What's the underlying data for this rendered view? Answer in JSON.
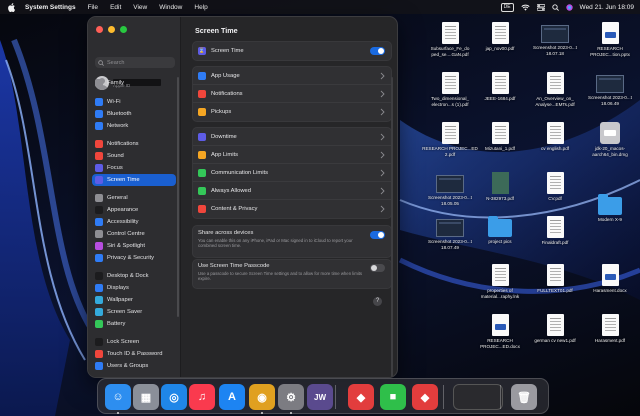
{
  "menubar": {
    "app_name": "System Settings",
    "menus": [
      "File",
      "Edit",
      "View",
      "Window",
      "Help"
    ],
    "input_source": "DE",
    "clock": "Wed 21. Jun  18:09"
  },
  "window": {
    "search": {
      "placeholder": "Search",
      "value": ""
    },
    "account": {
      "name": "",
      "subtitle": "Apple ID"
    },
    "sidebar": [
      {
        "label": "Family",
        "icon": "family-icon",
        "color": "#8e8e93"
      },
      {
        "label": "Wi-Fi",
        "icon": "wifi-icon",
        "color": "#2f7cf6"
      },
      {
        "label": "Bluetooth",
        "icon": "bluetooth-icon",
        "color": "#2f7cf6"
      },
      {
        "label": "Network",
        "icon": "network-icon",
        "color": "#2f7cf6"
      },
      {
        "label": "Notifications",
        "icon": "notifications-icon",
        "color": "#f0463c"
      },
      {
        "label": "Sound",
        "icon": "sound-icon",
        "color": "#f0463c"
      },
      {
        "label": "Focus",
        "icon": "focus-icon",
        "color": "#5e5ce6"
      },
      {
        "label": "Screen Time",
        "icon": "screen-time-icon",
        "color": "#5e5ce6",
        "selected": true
      },
      {
        "label": "General",
        "icon": "general-icon",
        "color": "#8e8e93"
      },
      {
        "label": "Appearance",
        "icon": "appearance-icon",
        "color": "#1c1c1e"
      },
      {
        "label": "Accessibility",
        "icon": "accessibility-icon",
        "color": "#2f7cf6"
      },
      {
        "label": "Control Centre",
        "icon": "control-centre-icon",
        "color": "#8e8e93"
      },
      {
        "label": "Siri & Spotlight",
        "icon": "siri-icon",
        "color": "#b84ee0"
      },
      {
        "label": "Privacy & Security",
        "icon": "privacy-icon",
        "color": "#2f7cf6"
      },
      {
        "label": "Desktop & Dock",
        "icon": "desktop-dock-icon",
        "color": "#1c1c1e"
      },
      {
        "label": "Displays",
        "icon": "displays-icon",
        "color": "#2f7cf6"
      },
      {
        "label": "Wallpaper",
        "icon": "wallpaper-icon",
        "color": "#34aadc"
      },
      {
        "label": "Screen Saver",
        "icon": "screen-saver-icon",
        "color": "#34aadc"
      },
      {
        "label": "Battery",
        "icon": "battery-icon",
        "color": "#34c759"
      },
      {
        "label": "Lock Screen",
        "icon": "lock-screen-icon",
        "color": "#1c1c1e"
      },
      {
        "label": "Touch ID & Password",
        "icon": "touch-id-icon",
        "color": "#f0463c"
      },
      {
        "label": "Users & Groups",
        "icon": "users-groups-icon",
        "color": "#2f7cf6"
      }
    ],
    "content": {
      "title": "Screen Time",
      "screen_time_row": {
        "label": "Screen Time",
        "icon": "screen-time-icon",
        "color": "#5e5ce6",
        "enabled": true
      },
      "group_a": [
        {
          "label": "App Usage",
          "icon": "app-usage-icon",
          "color": "#2f7cf6"
        },
        {
          "label": "Notifications",
          "icon": "notifications-icon",
          "color": "#f0463c"
        },
        {
          "label": "Pickups",
          "icon": "pickups-icon",
          "color": "#f5a623"
        }
      ],
      "group_b": [
        {
          "label": "Downtime",
          "icon": "downtime-icon",
          "color": "#5e5ce6"
        },
        {
          "label": "App Limits",
          "icon": "app-limits-icon",
          "color": "#f5a623"
        },
        {
          "label": "Communication Limits",
          "icon": "communication-limits-icon",
          "color": "#34c759"
        },
        {
          "label": "Always Allowed",
          "icon": "always-allowed-icon",
          "color": "#34c759"
        },
        {
          "label": "Content & Privacy",
          "icon": "content-privacy-icon",
          "color": "#f0463c"
        }
      ],
      "share": {
        "title": "Share across devices",
        "description": "You can enable this on any iPhone, iPad or Mac signed in to iCloud to report your combined screen time.",
        "enabled": true
      },
      "passcode": {
        "title": "Use Screen Time Passcode",
        "description": "Use a passcode to secure Screen Time settings and to allow for more time when limits expire.",
        "enabled": false
      },
      "help": "?"
    }
  },
  "desktop": {
    "files": [
      {
        "label": "Subsurface_Fe_do ped_se....GaN.pdf",
        "kind": "pdf"
      },
      {
        "label": "jap_nov00.pdf",
        "kind": "pdf"
      },
      {
        "label": "Screenshot 2023-0...t 18.07.18",
        "kind": "shot"
      },
      {
        "label": "RESEARCH PROJEC...tion.pptx",
        "kind": "doc"
      },
      {
        "label": "Two_dimensional_ electron...s (1).pdf",
        "kind": "pdf"
      },
      {
        "label": "JEEE-1684.pdf",
        "kind": "pdf"
      },
      {
        "label": "An_Overview_on_ Analyse...EMTs.pdf",
        "kind": "pdf"
      },
      {
        "label": "Screenshot 2023-0...t 18.06.49",
        "kind": "shot"
      },
      {
        "label": "RESEARCH PROJEC...ED 2.pdf",
        "kind": "pdf"
      },
      {
        "label": "Mizutani_1.pdf",
        "kind": "pdf"
      },
      {
        "label": "cv english.pdf",
        "kind": "pdf"
      },
      {
        "label": "jdk-20_macos- aarch64_bin.dmg",
        "kind": "disk"
      },
      {
        "label": "Screenshot 2023-0...t 18.05.05",
        "kind": "shot"
      },
      {
        "label": "N-382973.pdf",
        "kind": "cover"
      },
      {
        "label": "CV.pdf",
        "kind": "pdf"
      },
      {
        "label": "Modern X-9",
        "kind": "folder"
      },
      {
        "label": "Screenshot 2023-0...t 18.07.49",
        "kind": "shot"
      },
      {
        "label": "project pics",
        "kind": "folder"
      },
      {
        "label": "Finaldraft.pdf",
        "kind": "pdf"
      },
      {
        "label": "properties of material...raphy.lnk",
        "kind": "pdf"
      },
      {
        "label": "FULLTEXT01.pdf",
        "kind": "pdf"
      },
      {
        "label": "Harasment.docx",
        "kind": "doc"
      },
      {
        "label": "RESEARCH PROJEC...ED.docx",
        "kind": "doc"
      },
      {
        "label": "german cv new1.pdf",
        "kind": "pdf"
      },
      {
        "label": "Harasment.pdf",
        "kind": "pdf"
      }
    ]
  },
  "dock": [
    {
      "name": "finder",
      "glyph": "☺",
      "color": "#2d8ef0"
    },
    {
      "name": "launchpad",
      "glyph": "▦",
      "color": "#8a8f99"
    },
    {
      "name": "safari",
      "glyph": "◎",
      "color": "#1f86e8"
    },
    {
      "name": "music",
      "glyph": "♫",
      "color": "#fa3a4e"
    },
    {
      "name": "app-store",
      "glyph": "A",
      "color": "#1d84f2"
    },
    {
      "name": "chrome",
      "glyph": "◉",
      "color": "#e0a020"
    },
    {
      "name": "system-settings",
      "glyph": "⚙",
      "color": "#7c7c82"
    },
    {
      "name": "jw-library",
      "glyph": "JW",
      "color": "#5a4a8e"
    },
    {
      "name": "anydesk",
      "glyph": "◆",
      "color": "#e23d3d"
    },
    {
      "name": "facetime",
      "glyph": "■",
      "color": "#2fbf4a"
    },
    {
      "name": "anydesk-2",
      "glyph": "◆",
      "color": "#e23d3d"
    },
    {
      "name": "minimized-window",
      "glyph": "",
      "color": "#2a2a2e"
    },
    {
      "name": "trash",
      "glyph": "🗑",
      "color": "#9a9aa0"
    }
  ]
}
